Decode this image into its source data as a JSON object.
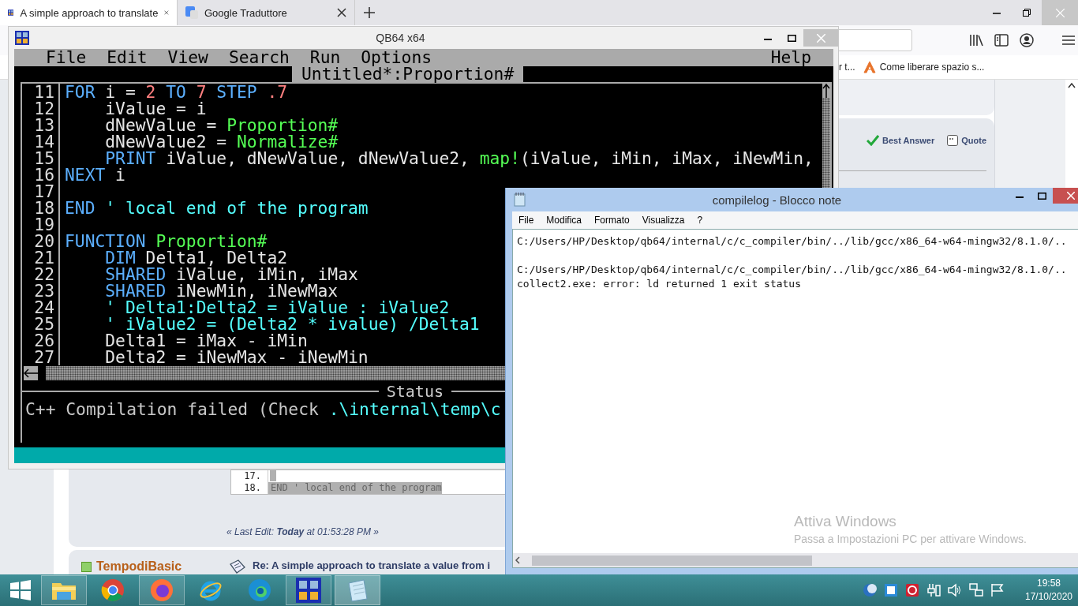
{
  "browser": {
    "tabs": [
      {
        "title": "A simple approach to translate",
        "selected": true
      },
      {
        "title": "Google Traduttore",
        "selected": false
      }
    ],
    "bookmarks": [
      "r t...",
      "Come liberare spazio s..."
    ],
    "post_actions": [
      "Best Answer",
      "Quote"
    ],
    "code_snippet": [
      {
        "number": "17.",
        "selected": true
      },
      {
        "number": "18.",
        "text": "END ' local end of the program",
        "selected": true
      }
    ],
    "last_edit": "« Last Edit: **Today** at 01:53:28 PM »",
    "next_post": {
      "author": "TempodiBasic",
      "subject": "Re: A simple approach to translate a value from i"
    }
  },
  "qb64": {
    "title": "QB64 x64",
    "menu": [
      "File",
      "Edit",
      "View",
      "Search",
      "Run",
      "Options"
    ],
    "help": "Help",
    "file_title": "Untitled*:Proportion#",
    "lines": [
      {
        "number": "11",
        "tokens": [
          {
            "kind": "keyword",
            "text": "FOR"
          },
          {
            "kind": "text",
            "text": " i = "
          },
          {
            "kind": "number",
            "text": "2"
          },
          {
            "kind": "keyword",
            "text": " TO"
          },
          {
            "kind": "number",
            "text": " 7"
          },
          {
            "kind": "keyword",
            "text": " STEP"
          },
          {
            "kind": "number",
            "text": " .7"
          }
        ]
      },
      {
        "number": "12",
        "tokens": [
          {
            "kind": "text",
            "text": "    iValue = i"
          }
        ]
      },
      {
        "number": "13",
        "tokens": [
          {
            "kind": "text",
            "text": "    dNewValue = "
          },
          {
            "kind": "function",
            "text": "Proportion#"
          }
        ]
      },
      {
        "number": "14",
        "tokens": [
          {
            "kind": "text",
            "text": "    dNewValue2 = "
          },
          {
            "kind": "function",
            "text": "Normalize#"
          }
        ]
      },
      {
        "number": "15",
        "tokens": [
          {
            "kind": "keyword",
            "text": "    PRINT"
          },
          {
            "kind": "text",
            "text": " iValue, dNewValue, dNewValue2, "
          },
          {
            "kind": "function",
            "text": "map!"
          },
          {
            "kind": "text",
            "text": "(iValue, iMin, iMax, iNewMin,"
          }
        ]
      },
      {
        "number": "16",
        "tokens": [
          {
            "kind": "keyword",
            "text": "NEXT"
          },
          {
            "kind": "text",
            "text": " i"
          }
        ]
      },
      {
        "number": "17"
      },
      {
        "number": "18",
        "tokens": [
          {
            "kind": "keyword",
            "text": "END"
          },
          {
            "kind": "comment",
            "text": " ' local end of the program"
          }
        ]
      },
      {
        "number": "19"
      },
      {
        "number": "20",
        "tokens": [
          {
            "kind": "keyword",
            "text": "FUNCTION"
          },
          {
            "kind": "function",
            "text": " Proportion#"
          }
        ]
      },
      {
        "number": "21",
        "tokens": [
          {
            "kind": "keyword",
            "text": "    DIM"
          },
          {
            "kind": "text",
            "text": " Delta1, Delta2"
          }
        ]
      },
      {
        "number": "22",
        "tokens": [
          {
            "kind": "keyword",
            "text": "    SHARED"
          },
          {
            "kind": "text",
            "text": " iValue, iMin, iMax"
          }
        ]
      },
      {
        "number": "23",
        "tokens": [
          {
            "kind": "keyword",
            "text": "    SHARED"
          },
          {
            "kind": "text",
            "text": " iNewMin, iNewMax"
          }
        ]
      },
      {
        "number": "24",
        "tokens": [
          {
            "kind": "comment",
            "text": "    ' Delta1:Delta2 = iValue : iValue2"
          }
        ]
      },
      {
        "number": "25",
        "tokens": [
          {
            "kind": "comment",
            "text": "    ' iValue2 = (Delta2 * ivalue) /Delta1"
          }
        ]
      },
      {
        "number": "26",
        "tokens": [
          {
            "kind": "text",
            "text": "    Delta1 = iMax - iMin"
          }
        ]
      },
      {
        "number": "27",
        "tokens": [
          {
            "kind": "text",
            "text": "    Delta2 = iNewMax - iNewMin"
          }
        ]
      }
    ],
    "status_label": "Status",
    "status": [
      {
        "kind": "text",
        "text": "C++ Compilation failed (Check "
      },
      {
        "kind": "path",
        "text": ".\\internal\\temp\\c"
      }
    ]
  },
  "notepad": {
    "title": "compilelog - Blocco note",
    "menu": [
      "File",
      "Modifica",
      "Formato",
      "Visualizza",
      "?"
    ],
    "paragraphs": [
      [
        "C:/Users/HP/Desktop/qb64/internal/c/c_compiler/bin/../lib/gcc/x86_64-w64-mingw32/8.1.0/.."
      ],
      [
        "C:/Users/HP/Desktop/qb64/internal/c/c_compiler/bin/../lib/gcc/x86_64-w64-mingw32/8.1.0/..",
        "collect2.exe: error: ld returned 1 exit status"
      ]
    ]
  },
  "activation": {
    "title": "Attiva Windows",
    "subtitle": "Passa a Impostazioni PC per attivare Windows."
  },
  "taskbar": {
    "time": "19:58",
    "date": "17/10/2020"
  }
}
